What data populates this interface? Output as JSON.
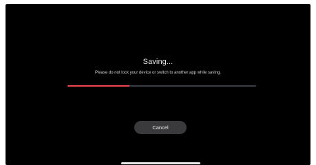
{
  "dialog": {
    "title": "Saving...",
    "message": "Please do not lock your device or switch to another app while saving.",
    "cancel_label": "Cancel"
  },
  "progress": {
    "fraction": 0.33,
    "fill_color": "#f2444e",
    "track_color": "#3a3e44"
  },
  "theme": {
    "background": "#000000",
    "button_background": "#3a3a3c"
  }
}
